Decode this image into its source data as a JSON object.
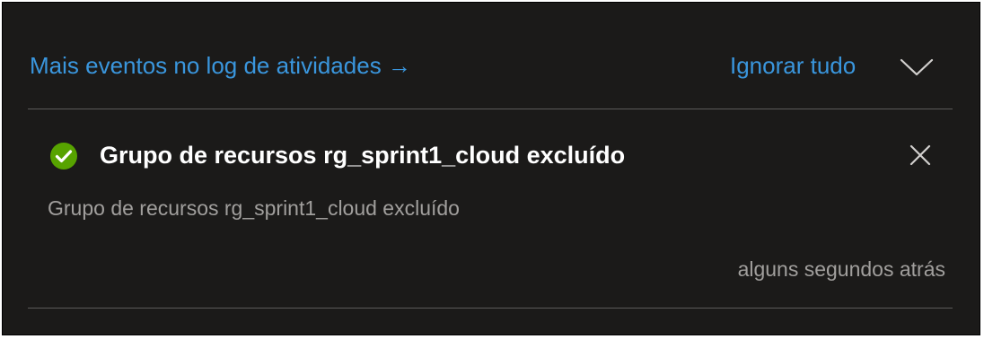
{
  "header": {
    "activity_log_link": "Mais eventos no log de atividades →",
    "dismiss_all_label": "Ignorar tudo",
    "collapse_icon": "chevron-down-icon"
  },
  "notification": {
    "status_icon": "success-check-icon",
    "title": "Grupo de recursos rg_sprint1_cloud excluído",
    "description": "Grupo de recursos rg_sprint1_cloud excluído",
    "timestamp": "alguns segundos atrás",
    "close_icon": "close-icon"
  },
  "colors": {
    "background": "#1b1a19",
    "link": "#3a96dd",
    "success": "#57a300",
    "title_text": "#ffffff",
    "secondary_text": "#a19f9d",
    "divider": "#5c5b59"
  }
}
